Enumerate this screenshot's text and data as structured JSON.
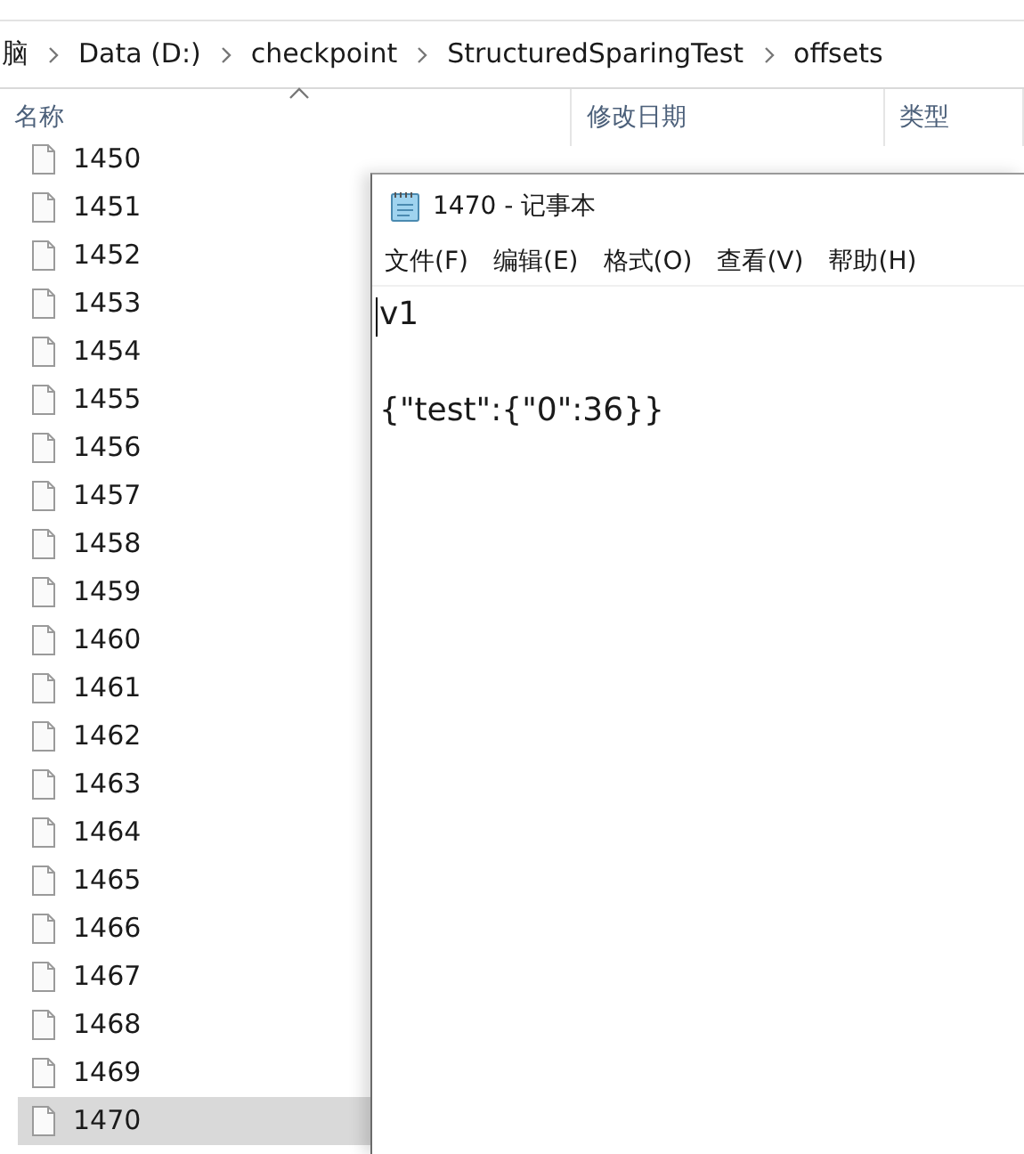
{
  "explorer": {
    "breadcrumb": [
      "脑",
      "Data (D:)",
      "checkpoint",
      "StructuredSparingTest",
      "offsets"
    ],
    "columns": [
      "名称",
      "修改日期",
      "类型"
    ],
    "files": [
      {
        "name": "1450",
        "selected": false
      },
      {
        "name": "1451",
        "selected": false
      },
      {
        "name": "1452",
        "selected": false
      },
      {
        "name": "1453",
        "selected": false
      },
      {
        "name": "1454",
        "selected": false
      },
      {
        "name": "1455",
        "selected": false
      },
      {
        "name": "1456",
        "selected": false
      },
      {
        "name": "1457",
        "selected": false
      },
      {
        "name": "1458",
        "selected": false
      },
      {
        "name": "1459",
        "selected": false
      },
      {
        "name": "1460",
        "selected": false
      },
      {
        "name": "1461",
        "selected": false
      },
      {
        "name": "1462",
        "selected": false
      },
      {
        "name": "1463",
        "selected": false
      },
      {
        "name": "1464",
        "selected": false
      },
      {
        "name": "1465",
        "selected": false
      },
      {
        "name": "1466",
        "selected": false
      },
      {
        "name": "1467",
        "selected": false
      },
      {
        "name": "1468",
        "selected": false
      },
      {
        "name": "1469",
        "selected": false
      },
      {
        "name": "1470",
        "selected": true
      }
    ]
  },
  "notepad": {
    "title": "1470 - 记事本",
    "menu": [
      "文件(F)",
      "编辑(E)",
      "格式(O)",
      "查看(V)",
      "帮助(H)"
    ],
    "text": "v1\n\n{\"test\":{\"0\":36}}"
  }
}
